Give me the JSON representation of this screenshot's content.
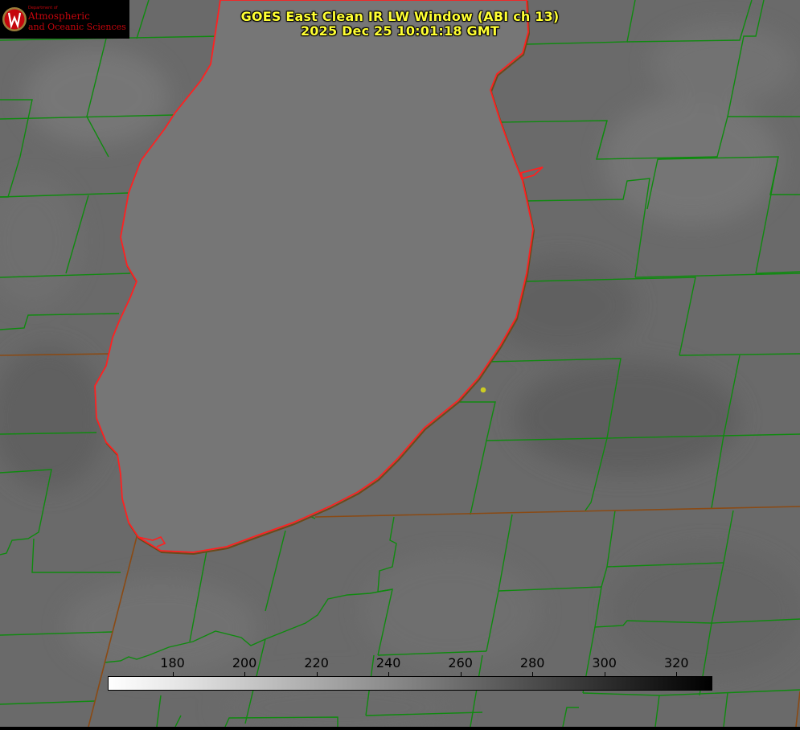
{
  "title": {
    "line1": "GOES East Clean IR LW Window (ABI ch 13)",
    "line2": "2025 Dec 25 10:01:18 GMT"
  },
  "logo": {
    "small_text": "Department of",
    "line1": "Atmospheric",
    "line2": "and Oceanic Sciences",
    "color": "#c5050c"
  },
  "colorbar": {
    "ticks": [
      "180",
      "200",
      "220",
      "240",
      "260",
      "280",
      "300",
      "320"
    ],
    "tick_values": [
      180,
      200,
      220,
      240,
      260,
      280,
      300,
      320
    ],
    "range": [
      162,
      330
    ],
    "colormap": "white-to-black (cold=white, warm=black)"
  },
  "colors": {
    "land": "#6b6b6b",
    "lake": "#747474",
    "county_lines": "#0f8a0f",
    "state_lines": "#8a4a14",
    "lakeshore": "#ff2020",
    "marker": "#cccc22",
    "title": "#ffff33"
  }
}
